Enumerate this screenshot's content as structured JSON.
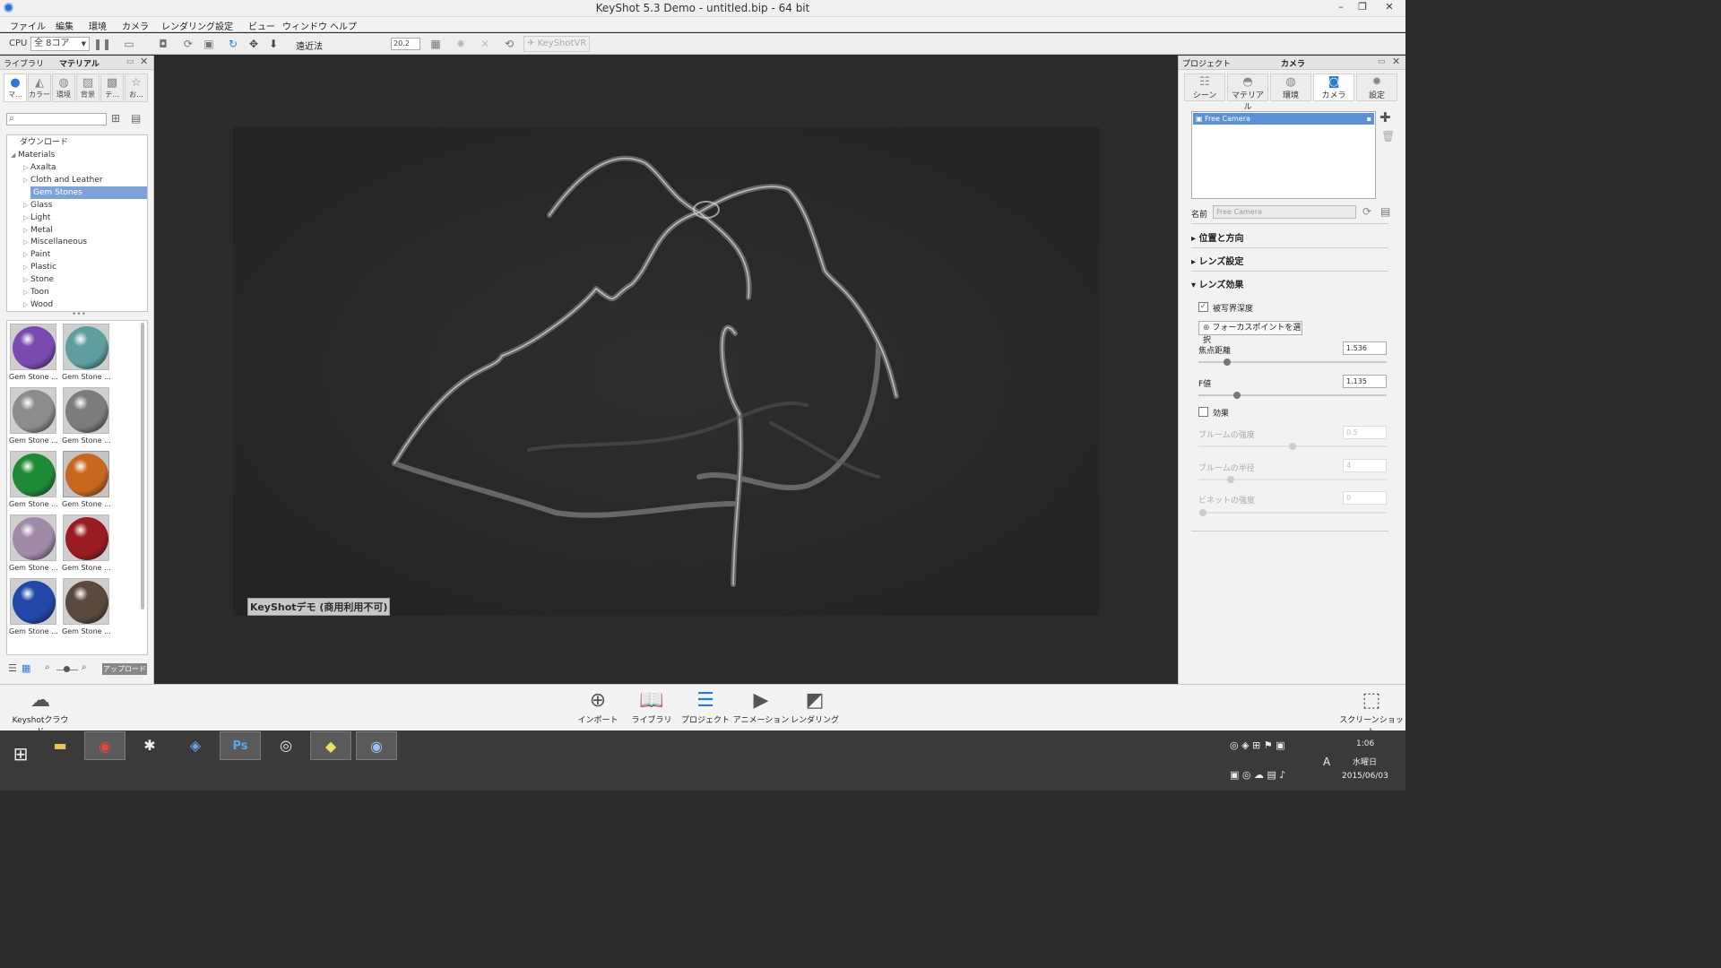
{
  "window": {
    "title": "KeyShot 5.3 Demo  - untitled.bip  - 64 bit"
  },
  "menu": [
    "ファイル",
    "編集",
    "環境",
    "カメラ",
    "レンダリング",
    "設定",
    "ビュー",
    "ウィンドウ",
    "ヘルプ"
  ],
  "toolbar": {
    "cpu_label": "CPU",
    "cores": "全 8コア",
    "perspective_label": "遠近法",
    "perspective_value": "20.2",
    "vr_label": "KeyShotVR"
  },
  "left_panel": {
    "tab_library": "ライブラリ",
    "tab_material": "マテリアル",
    "categories": [
      "マ...",
      "カラー",
      "環境",
      "背景",
      "テ...",
      "お..."
    ],
    "tree_root": "ダウンロード",
    "tree_materials": "Materials",
    "tree_items": [
      "Axalta",
      "Cloth and Leather",
      "Gem Stones",
      "Glass",
      "Light",
      "Metal",
      "Miscellaneous",
      "Paint",
      "Plastic",
      "Stone",
      "Toon",
      "Wood"
    ],
    "selected_item": "Gem Stones",
    "thumbnails": [
      {
        "caption": "Gem Stone ...",
        "color": "#7a4ab0"
      },
      {
        "caption": "Gem Stone ...",
        "color": "#5f9e9e"
      },
      {
        "caption": "Gem Stone ...",
        "color": "#8c8c8c"
      },
      {
        "caption": "Gem Stone ...",
        "color": "#7c7c7c"
      },
      {
        "caption": "Gem Stone ...",
        "color": "#1f8a35"
      },
      {
        "caption": "Gem Stone ...",
        "color": "#c8681e"
      },
      {
        "caption": "Gem Stone ...",
        "color": "#a08aa8"
      },
      {
        "caption": "Gem Stone ...",
        "color": "#9a1c22"
      },
      {
        "caption": "Gem Stone ...",
        "color": "#2148a8"
      },
      {
        "caption": "Gem Stone ...",
        "color": "#5b4a3c"
      }
    ],
    "upload_label": "アップロード"
  },
  "viewport": {
    "watermark": "KeyShotデモ (商用利用不可)"
  },
  "right_panel": {
    "tab_project": "プロジェクト",
    "tab_camera": "カメラ",
    "tabs": [
      "シーン",
      "マテリアル",
      "環境",
      "カメラ",
      "設定"
    ],
    "active_tab": "カメラ",
    "camera_item": "Free Camera",
    "name_label": "名前",
    "name_value": "Free Camera",
    "section_position": "位置と方向",
    "section_lens": "レンズ設定",
    "section_effects": "レンズ効果",
    "dof_label": "被写界深度",
    "dof_checked": true,
    "focus_button": "フォーカスポイントを選択",
    "focus_distance_label": "焦点距離",
    "focus_distance_value": "1.536",
    "fstop_label": "F値",
    "fstop_value": "1.135",
    "effects_label": "効果",
    "bloom_strength_label": "ブルームの強度",
    "bloom_strength_value": "0.5",
    "bloom_radius_label": "ブルームの半径",
    "bloom_radius_value": "4",
    "vignette_label": "ビネットの強度",
    "vignette_value": "0"
  },
  "dock": {
    "cloud": "Keyshotクラウド",
    "import": "インポート",
    "library": "ライブラリ",
    "project": "プロジェクト",
    "animation": "アニメーション",
    "render": "レンダリング",
    "screenshot": "スクリーンショット"
  },
  "taskbar": {
    "time": "1:06",
    "weekday": "水曜日",
    "date": "2015/06/03",
    "ime": "A"
  }
}
